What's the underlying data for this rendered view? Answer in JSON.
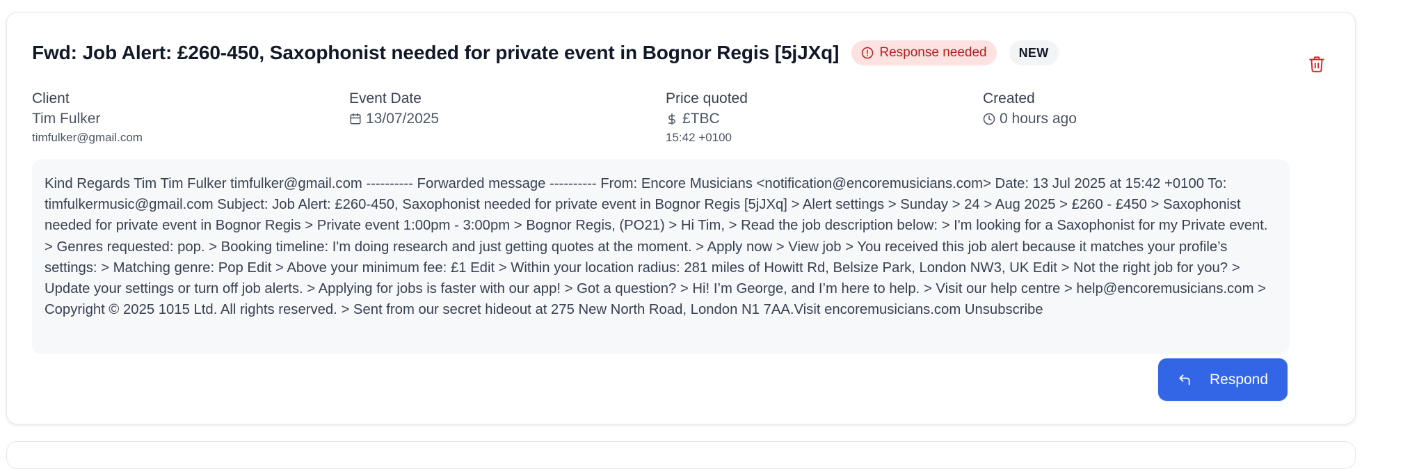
{
  "job": {
    "title": "Fwd: Job Alert: £260-450, Saxophonist needed for private event in Bognor Regis [5jJXq]",
    "badge_alert": "Response needed",
    "badge_new": "NEW",
    "client": {
      "label": "Client",
      "name": "Tim Fulker",
      "email": "timfulker@gmail.com"
    },
    "event_date": {
      "label": "Event Date",
      "value": "13/07/2025"
    },
    "price": {
      "label": "Price quoted",
      "value": "£TBC",
      "sub": "15:42 +0100"
    },
    "created": {
      "label": "Created",
      "value": "0 hours ago"
    },
    "message": "Kind Regards Tim Tim Fulker timfulker@gmail.com ---------- Forwarded message ---------- From: Encore Musicians <notification@encoremusicians.com> Date: 13 Jul 2025 at 15:42 +0100 To: timfulkermusic@gmail.com Subject: Job Alert: £260-450, Saxophonist needed for private event in Bognor Regis [5jJXq] > Alert settings > Sunday > 24 > Aug 2025 > £260 - £450 > Saxophonist needed for private event in Bognor Regis > Private event 1:00pm - 3:00pm > Bognor Regis, (PO21) > Hi Tim, > Read the job description below: > I'm looking for a Saxophonist for my Private event. > Genres requested: pop. > Booking timeline: I'm doing research and just getting quotes at the moment. > Apply now > View job > You received this job alert because it matches your profile’s settings: > Matching genre: Pop Edit > Above your minimum fee: £1 Edit > Within your location radius: 281 miles of Howitt Rd, Belsize Park, London NW3, UK Edit > Not the right job for you? > Update your settings or turn off job alerts. > Applying for jobs is faster with our app! > Got a question? > Hi! I’m George, and I’m here to help. > Visit our help centre > help@encoremusicians.com > Copyright © 2025 1015 Ltd. All rights reserved. > Sent from our secret hideout at 275 New North Road, London N1 7AA.Visit encoremusicians.com Unsubscribe",
    "respond_label": "Respond"
  },
  "icons": {
    "alert": "alert-circle-icon",
    "trash": "trash-icon",
    "calendar": "calendar-icon",
    "dollar": "dollar-icon",
    "clock": "clock-icon",
    "reply": "reply-icon"
  },
  "colors": {
    "accent": "#3366e6",
    "danger": "#dc2626",
    "alert_bg": "#fde2e2"
  }
}
